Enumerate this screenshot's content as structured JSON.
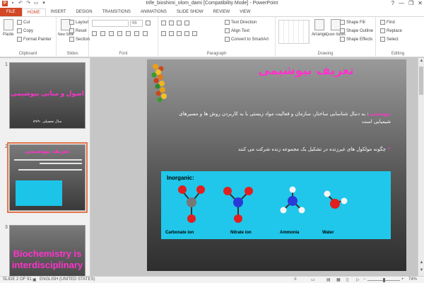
{
  "window": {
    "title": "trife_bioshimi_olom_dami [Compatibility Mode] - PowerPoint",
    "controls": [
      "?",
      "—",
      "❐",
      "✕"
    ]
  },
  "tabs": [
    "FILE",
    "HOME",
    "INSERT",
    "DESIGN",
    "TRANSITIONS",
    "ANIMATIONS",
    "SLIDE SHOW",
    "REVIEW",
    "VIEW"
  ],
  "ribbon": {
    "clipboard": {
      "paste": "Paste",
      "cut": "Cut",
      "copy": "Copy",
      "format_painter": "Format Painter",
      "label": "Clipboard"
    },
    "slides": {
      "new_slide": "New Slide",
      "layout": "Layout",
      "reset": "Reset",
      "section": "Section",
      "label": "Slides"
    },
    "font": {
      "font_name": "",
      "font_size": "66",
      "label": "Font"
    },
    "paragraph": {
      "text_direction": "Text Direction",
      "align_text": "Align Text",
      "convert_smartart": "Convert to SmartArt",
      "label": "Paragraph"
    },
    "drawing": {
      "arrange": "Arrange",
      "quick_styles": "Quick Styles",
      "shape_fill": "Shape Fill",
      "shape_outline": "Shape Outline",
      "shape_effects": "Shape Effects",
      "label": "Drawing"
    },
    "editing": {
      "find": "Find",
      "replace": "Replace",
      "select": "Select",
      "label": "Editing"
    }
  },
  "thumbnails": [
    {
      "number": "1",
      "title": "اصول و مبانی بیوشیمی",
      "subtitle": "سال تحصیلی ۸۹/۹۰"
    },
    {
      "number": "2",
      "title": "تعریف بیوشیمی"
    },
    {
      "number": "3",
      "title": "Biochemistry is interdisciplinary"
    }
  ],
  "slide": {
    "title": "تعریف بیوشیمی",
    "para1_highlight": "بیوشیمی",
    "para1_line1": ": به دنبال شناسایی ساختار، سازمان و فعالیت مواد زیستی با به کاربردن روش ها و مسیرهای",
    "para1_line2": "شیمیایی است",
    "bullet_mark": "•",
    "para2": "چگونه مولکول های غیرزنده در تشکیل یک مجموعه زنده شرکت می کنند",
    "molecules": {
      "heading": "Inorganic:",
      "labels": [
        "Carbonate ion",
        "Nitrate ion",
        "Ammonia",
        "Water"
      ]
    }
  },
  "status": {
    "slide_of": "SLIDE 2 OF 91",
    "language": "ENGLISH (UNITED STATES)",
    "zoom": "74%"
  },
  "colors": {
    "accent": "#d24726",
    "slide_title": "#ff33cc",
    "molecule_panel": "#20c7ea"
  }
}
